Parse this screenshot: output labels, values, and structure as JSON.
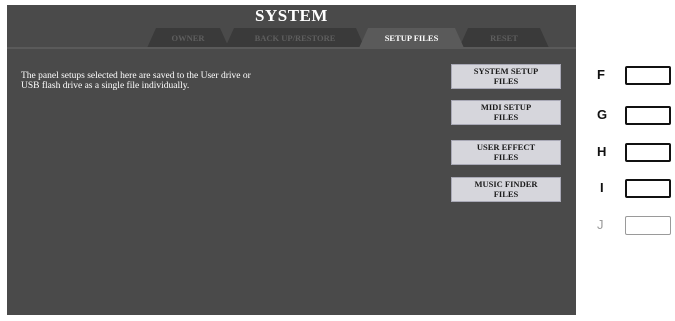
{
  "window": {
    "title": "SYSTEM"
  },
  "tabs": [
    {
      "label": "OWNER",
      "active": false
    },
    {
      "label": "BACK UP/RESTORE",
      "active": false
    },
    {
      "label": "SETUP FILES",
      "active": true
    },
    {
      "label": "RESET",
      "active": false
    }
  ],
  "main": {
    "description_line1": "The panel setups selected here are saved to the User drive or",
    "description_line2": "USB flash drive as a single file individually."
  },
  "buttons": [
    {
      "line1": "SYSTEM SETUP",
      "line2": "FILES"
    },
    {
      "line1": "MIDI SETUP",
      "line2": "FILES"
    },
    {
      "line1": "USER EFFECT",
      "line2": "FILES"
    },
    {
      "line1": "MUSIC FINDER",
      "line2": "FILES"
    }
  ],
  "external_buttons": [
    {
      "letter": "F",
      "enabled": true
    },
    {
      "letter": "G",
      "enabled": true
    },
    {
      "letter": "H",
      "enabled": true
    },
    {
      "letter": "I",
      "enabled": true
    },
    {
      "letter": "J",
      "enabled": false
    }
  ],
  "colors": {
    "screen_bg": "#4a4a4a",
    "button_bg": "#d6d6dc",
    "tab_active": "#5a5a5a",
    "tab_inactive": "#3a3a3a"
  }
}
